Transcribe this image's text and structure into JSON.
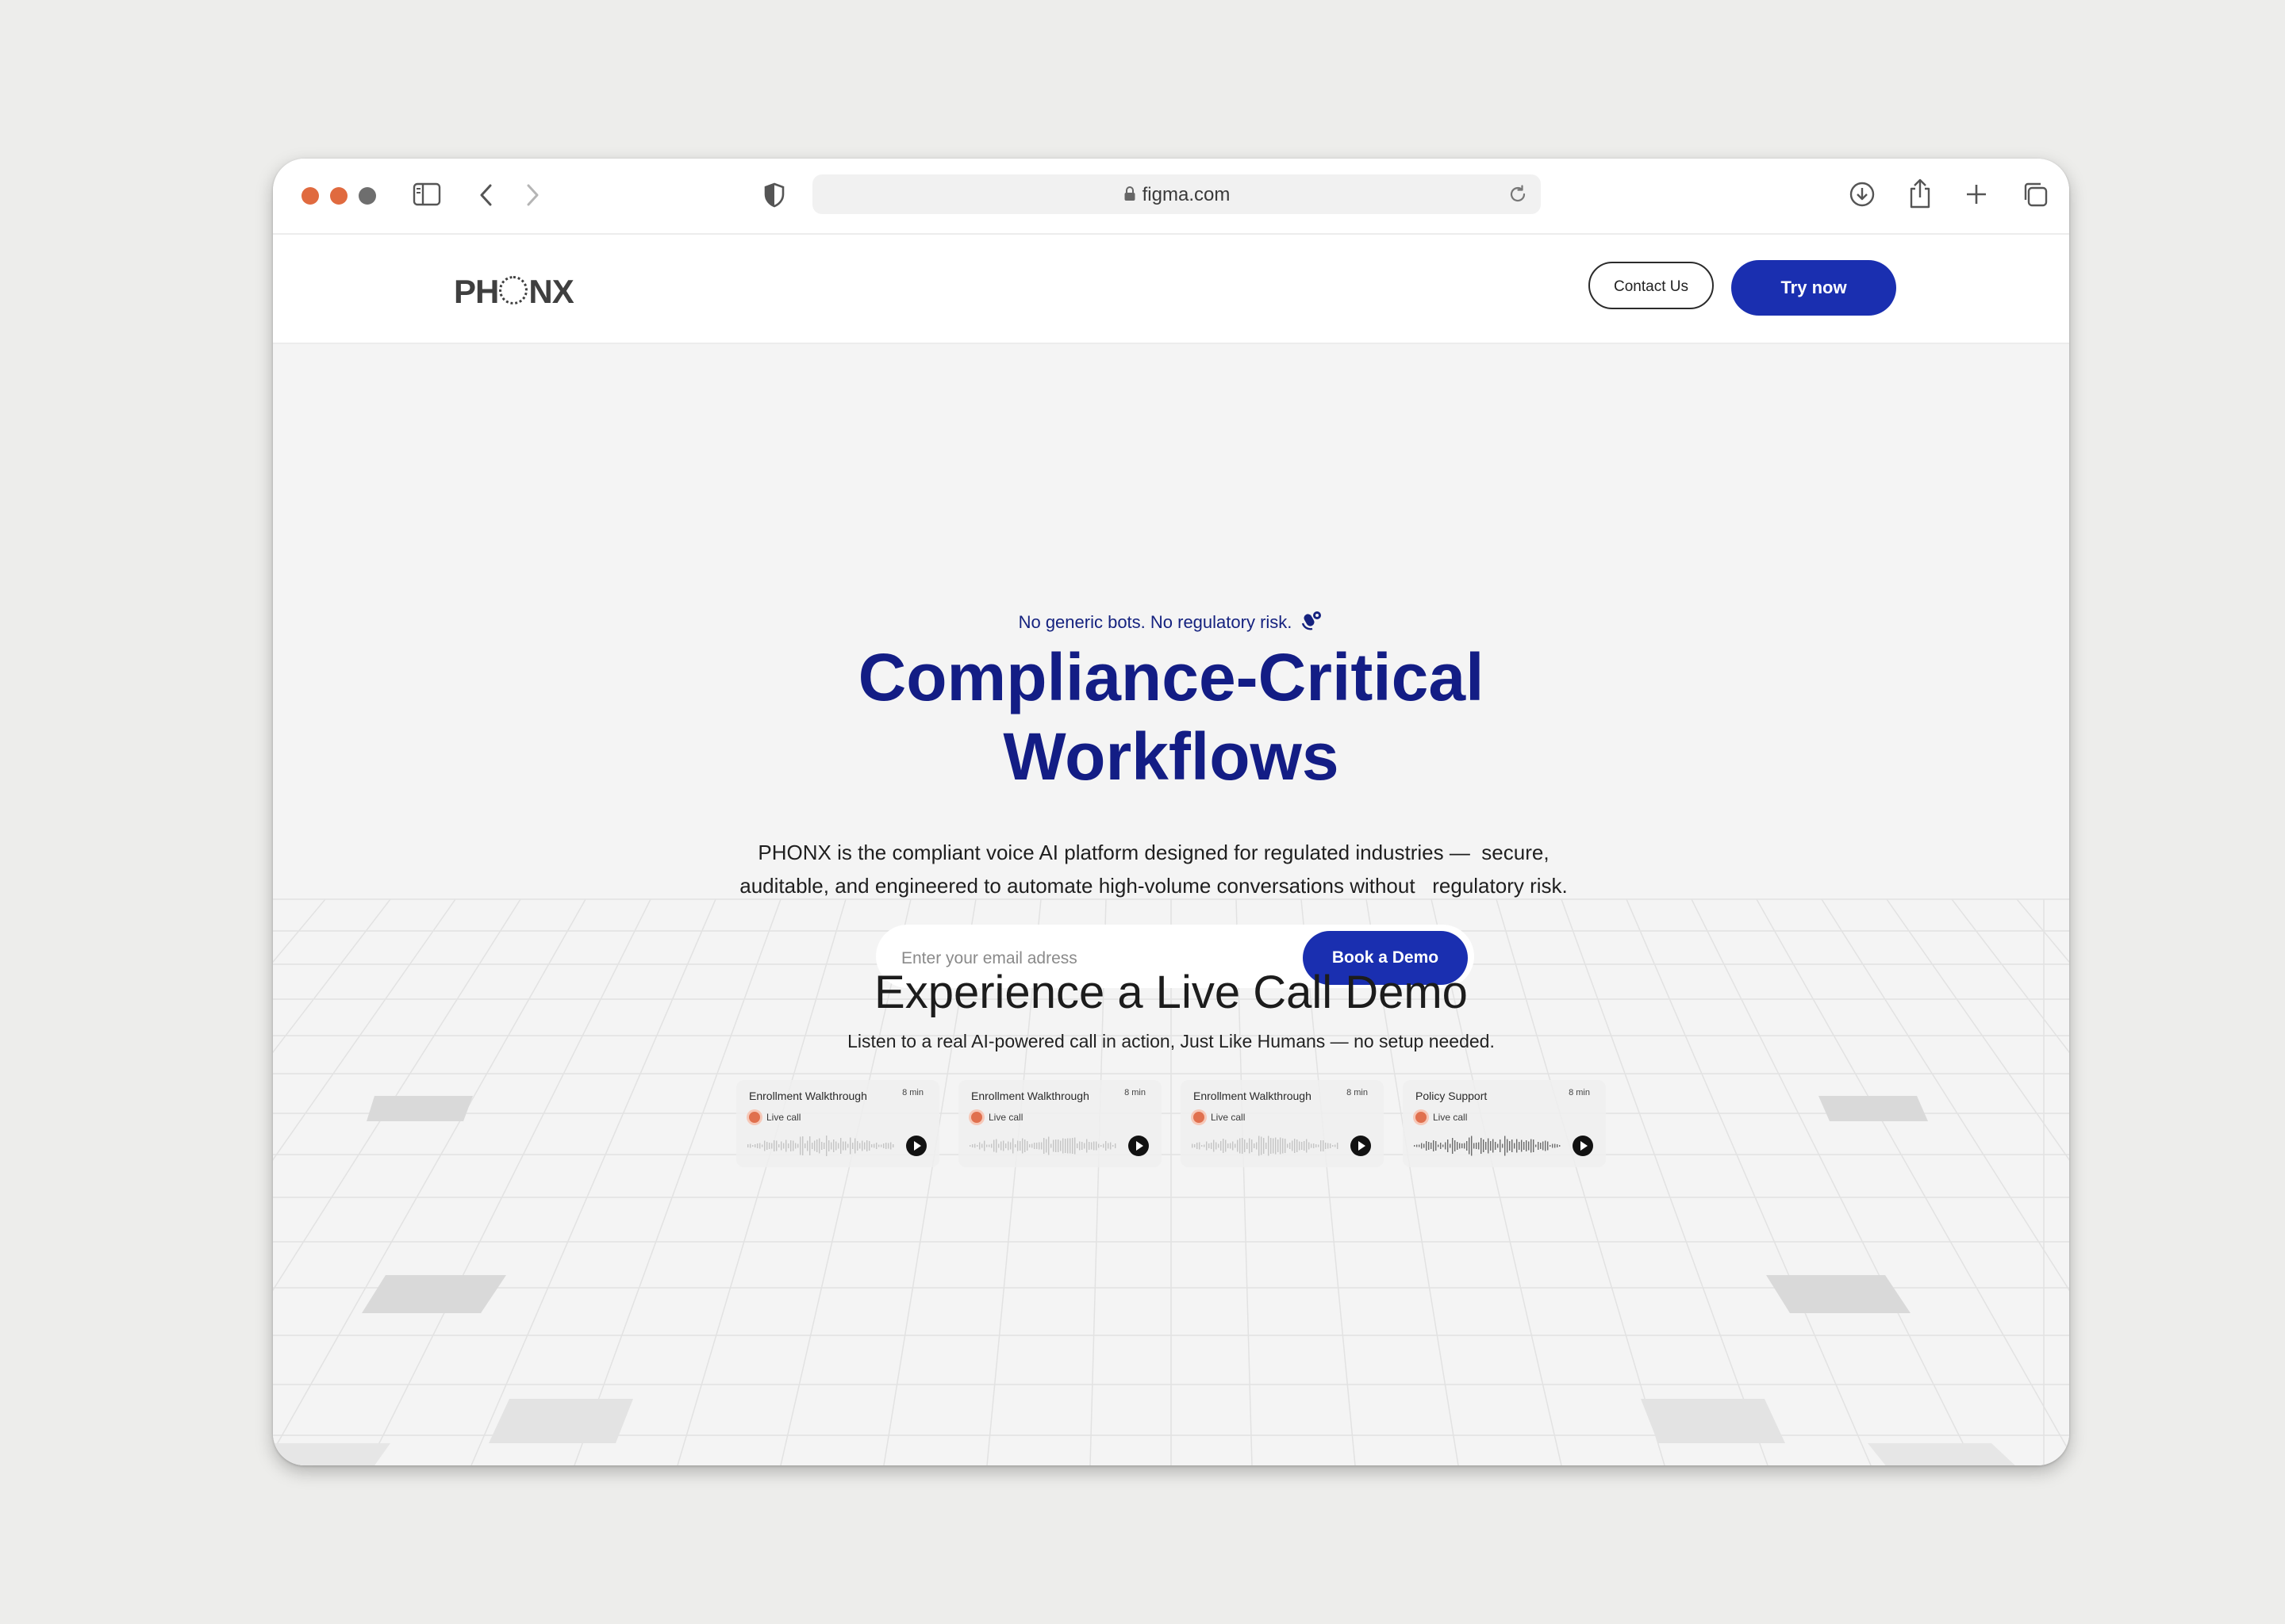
{
  "browser": {
    "url": "figma.com",
    "traffic_lights": [
      "#e06a3f",
      "#e06a3f",
      "#6e6e6e"
    ],
    "icons": [
      "sidebar-icon",
      "back-icon",
      "forward-icon",
      "shield-icon",
      "lock-icon",
      "reload-icon",
      "download-icon",
      "share-icon",
      "new-tab-icon",
      "tabs-overview-icon"
    ]
  },
  "header": {
    "logo_left": "PH",
    "logo_right": "NX",
    "contact_label": "Contact Us",
    "try_label": "Try now"
  },
  "hero": {
    "tagline": "No generic bots. No regulatory risk.",
    "headline_line1": "Compliance-Critical",
    "headline_line2": "Workflows",
    "lede_line1": "PHONX is the compliant voice AI platform designed for regulated industries —  secure,",
    "lede_line2": "auditable, and engineered to automate high-volume conversations without   regulatory risk.",
    "email_placeholder": "Enter your email adress",
    "demo_button": "Book a Demo"
  },
  "demo": {
    "title": "Experience a Live Call Demo",
    "subtitle": "Listen to a real AI-powered call in action, Just Like Humans — no setup needed.",
    "cards": [
      {
        "title": "Enrollment Walkthrough",
        "duration": "8 min",
        "status": "Live call"
      },
      {
        "title": "Enrollment Walkthrough",
        "duration": "8 min",
        "status": "Live call"
      },
      {
        "title": "Enrollment Walkthrough",
        "duration": "8 min",
        "status": "Live call"
      },
      {
        "title": "Policy Support",
        "duration": "8 min",
        "status": "Live call"
      }
    ]
  },
  "colors": {
    "brand_blue": "#1a2fb0",
    "headline_navy": "#131d85",
    "live_dot": "#e0704e"
  }
}
